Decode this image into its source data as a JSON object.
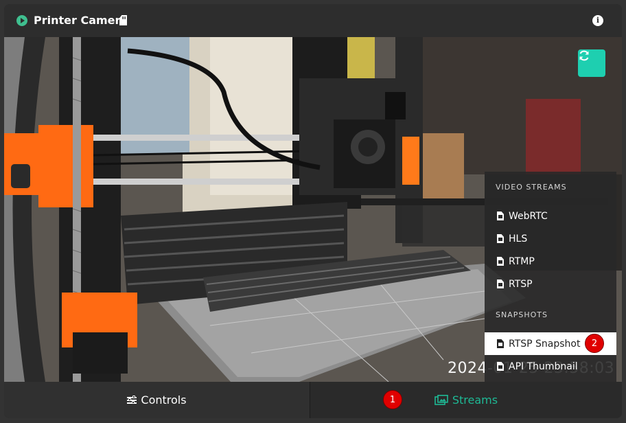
{
  "header": {
    "title": "Printer Camera",
    "icons": [
      "play-circle-icon",
      "sd-card-icon",
      "info-icon"
    ]
  },
  "camera": {
    "timestamp": "2024-01-25 23:58:03",
    "refresh_icon": "refresh-icon"
  },
  "menu": {
    "video_streams_header": "VIDEO STREAMS",
    "video_streams": [
      {
        "label": "WebRTC",
        "icon": "file-video-icon"
      },
      {
        "label": "HLS",
        "icon": "file-video-icon"
      },
      {
        "label": "RTMP",
        "icon": "file-video-icon"
      },
      {
        "label": "RTSP",
        "icon": "file-video-icon"
      }
    ],
    "snapshots_header": "SNAPSHOTS",
    "snapshots": [
      {
        "label": "RTSP Snapshot",
        "icon": "file-image-icon",
        "active": true
      },
      {
        "label": "API Thumbnail",
        "icon": "file-image-icon",
        "active": false
      }
    ]
  },
  "tabs": {
    "controls": "Controls",
    "streams": "Streams"
  },
  "badges": {
    "step1": "1",
    "step2": "2"
  },
  "colors": {
    "accent": "#1eb995",
    "refresh_button": "#1ecfb0",
    "badge": "#e00000",
    "printer_orange": "#ff6a13"
  }
}
